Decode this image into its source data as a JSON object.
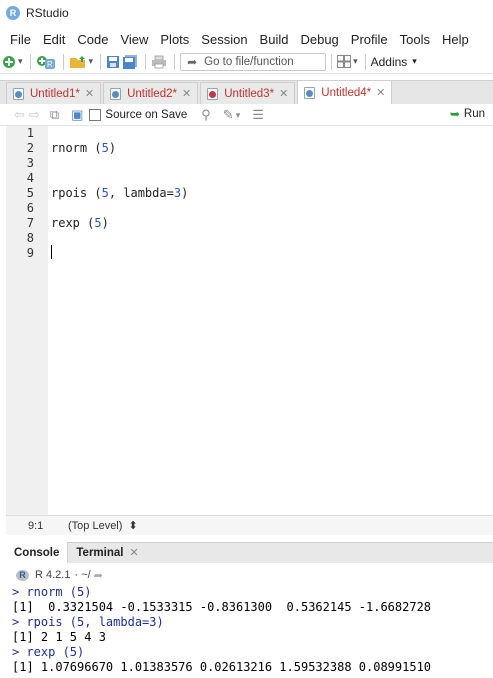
{
  "window": {
    "title": "RStudio",
    "logo": "R"
  },
  "menu": [
    "File",
    "Edit",
    "Code",
    "View",
    "Plots",
    "Session",
    "Build",
    "Debug",
    "Profile",
    "Tools",
    "Help"
  ],
  "toolbar": {
    "goto_placeholder": "Go to file/function",
    "addins_label": "Addins",
    "addins_chevron": "▾"
  },
  "tabs": [
    {
      "label": "Untitled1*",
      "icon": "r-doc-icon",
      "active": false
    },
    {
      "label": "Untitled2*",
      "icon": "r-doc-icon",
      "active": false
    },
    {
      "label": "Untitled3*",
      "icon": "r-doc-red-icon",
      "active": false
    },
    {
      "label": "Untitled4*",
      "icon": "r-doc-icon",
      "active": true
    }
  ],
  "editor_toolbar": {
    "source_on_save": "Source on Save",
    "run_label": "Run"
  },
  "editor": {
    "line_numbers": [
      "1",
      "2",
      "3",
      "4",
      "5",
      "6",
      "7",
      "8",
      "9"
    ],
    "lines": [
      {
        "fn": "",
        "args": ""
      },
      {
        "fn": "rnorm (",
        "num": "5",
        "rest": ")"
      },
      {
        "fn": "",
        "num": "",
        "rest": ""
      },
      {
        "fn": "",
        "num": "",
        "rest": ""
      },
      {
        "fn": "rpois (",
        "num": "5",
        "mid": ", lambda=",
        "num2": "3",
        "rest": ")"
      },
      {
        "fn": "",
        "num": "",
        "rest": ""
      },
      {
        "fn": "rexp (",
        "num": "5",
        "rest": ")"
      },
      {
        "fn": "",
        "num": "",
        "rest": ""
      },
      {
        "fn": "",
        "num": "",
        "rest": ""
      }
    ]
  },
  "status": {
    "position": "9:1",
    "scope": "(Top Level)",
    "scope_chevron": "⬍"
  },
  "console_tabs": {
    "console": "Console",
    "terminal": "Terminal"
  },
  "console_head": {
    "version": "R 4.2.1",
    "path": "· ~/"
  },
  "console_lines": [
    {
      "type": "cmd",
      "text": "> rnorm (5)"
    },
    {
      "type": "out",
      "text": "[1]  0.3321504 -0.1533315 -0.8361300  0.5362145 -1.6682728"
    },
    {
      "type": "cmd",
      "text": "> rpois (5, lambda=3)"
    },
    {
      "type": "out",
      "text": "[1] 2 1 5 4 3"
    },
    {
      "type": "cmd",
      "text": "> rexp (5)"
    },
    {
      "type": "out",
      "text": "[1] 1.07696670 1.01383576 0.02613216 1.59532388 0.08991510"
    }
  ]
}
